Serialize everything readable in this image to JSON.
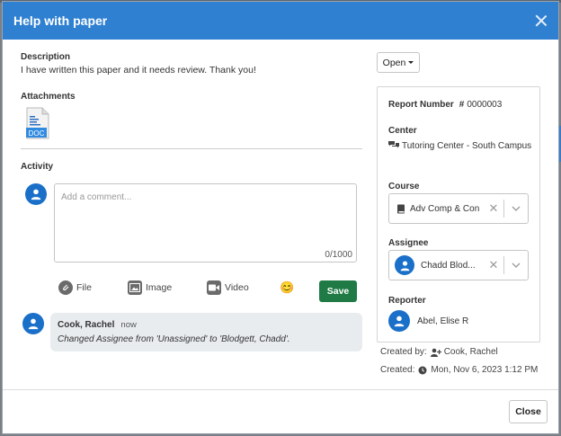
{
  "dialog": {
    "title": "Help with paper"
  },
  "description": {
    "label": "Description",
    "text": "I have written this paper and it needs review. Thank you!"
  },
  "attachments": {
    "label": "Attachments",
    "file_badge": "DOC"
  },
  "activity": {
    "label": "Activity",
    "comment_placeholder": "Add a comment...",
    "char_count": "0/1000",
    "tools": {
      "file": "File",
      "image": "Image",
      "video": "Video",
      "emoji": "😊"
    },
    "save_label": "Save",
    "log": [
      {
        "author": "Cook, Rachel",
        "time": "now",
        "message": "Changed Assignee from 'Unassigned' to 'Blodgett, Chadd'."
      }
    ]
  },
  "side": {
    "open_label": "Open",
    "report_number_label": "Report Number",
    "report_number_value": "0000003",
    "center_label": "Center",
    "center_value": "Tutoring Center - South Campus",
    "course_label": "Course",
    "course_value": "Adv Comp & Con",
    "assignee_label": "Assignee",
    "assignee_value": "Chadd Blod...",
    "reporter_label": "Reporter",
    "reporter_value": "Abel, Elise R",
    "created_by_label": "Created by:",
    "created_by_value": "Cook, Rachel",
    "created_label": "Created:",
    "created_value": "Mon, Nov 6, 2023 1:12 PM"
  },
  "footer": {
    "close_label": "Close"
  },
  "colors": {
    "header": "#2f80d1",
    "save": "#1f7a45",
    "avatar": "#1a6fc9"
  }
}
